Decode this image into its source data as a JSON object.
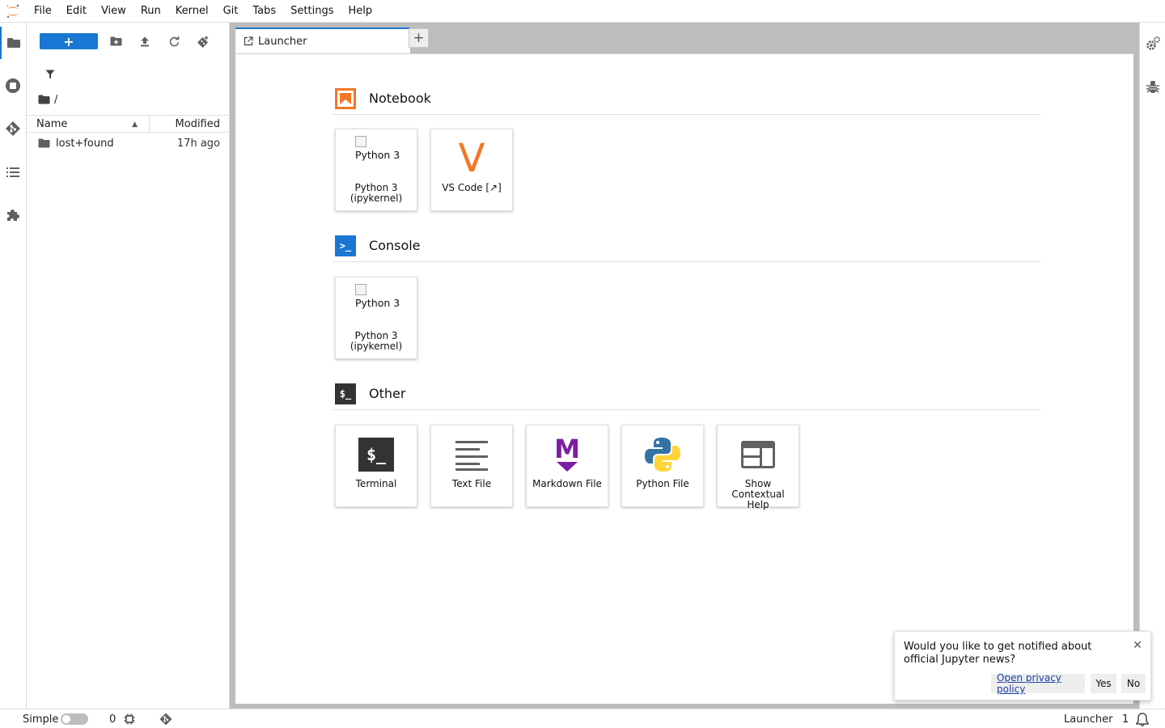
{
  "menubar": {
    "items": [
      "File",
      "Edit",
      "View",
      "Run",
      "Kernel",
      "Git",
      "Tabs",
      "Settings",
      "Help"
    ]
  },
  "left_sidebar": {
    "icons": [
      "folder-icon",
      "running-icon",
      "git-icon",
      "toc-icon",
      "extension-icon"
    ]
  },
  "filebrowser": {
    "new_label": "+",
    "breadcrumb": "/",
    "columns": {
      "name": "Name",
      "modified": "Modified"
    },
    "rows": [
      {
        "name": "lost+found",
        "modified": "17h ago"
      }
    ]
  },
  "tabs": [
    {
      "label": "Launcher"
    }
  ],
  "tab_add_label": "+",
  "launcher": {
    "sections": [
      {
        "title": "Notebook",
        "items": [
          {
            "label": "Python 3 (ipykernel)",
            "broken_alt": "Python 3"
          },
          {
            "label": "VS Code [↗]",
            "glyph": "V"
          }
        ]
      },
      {
        "title": "Console",
        "items": [
          {
            "label": "Python 3 (ipykernel)",
            "broken_alt": "Python 3"
          }
        ]
      },
      {
        "title": "Other",
        "items": [
          {
            "label": "Terminal",
            "glyph": "$_"
          },
          {
            "label": "Text File"
          },
          {
            "label": "Markdown File",
            "glyph": "M"
          },
          {
            "label": "Python File"
          },
          {
            "label": "Show Contextual Help"
          }
        ]
      }
    ],
    "section_glyphs": {
      "console": ">_",
      "other": "$_"
    }
  },
  "statusbar": {
    "mode_label": "Simple",
    "kernel_count": "0",
    "active_tab": "Launcher",
    "notification_count": "1"
  },
  "notification": {
    "message": "Would you like to get notified about official Jupyter news?",
    "privacy_link": "Open privacy policy",
    "yes": "Yes",
    "no": "No",
    "close": "✕"
  },
  "colors": {
    "accent": "#1976d2",
    "notebook_orange": "#f37726",
    "console_blue": "#0d47a1",
    "markdown_purple": "#7b1fa2",
    "python_blue": "#3572a5",
    "python_yellow": "#ffd43b"
  }
}
